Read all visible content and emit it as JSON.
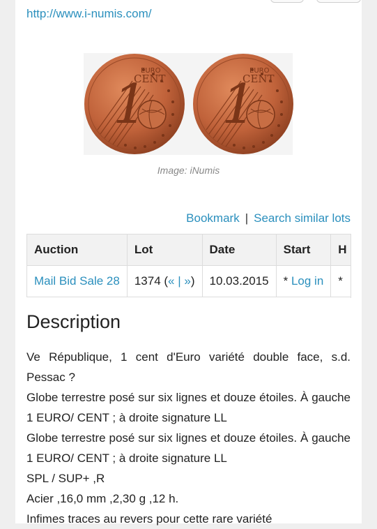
{
  "header": {
    "url": "http://www.i-numis.com/"
  },
  "image": {
    "caption": "Image: iNumis",
    "coin_left": {
      "numeral": "1",
      "label_top": "EURO",
      "label_bottom": "CENT"
    },
    "coin_right": {
      "numeral": "1",
      "label_top": "EURO",
      "label_bottom": "CENT"
    }
  },
  "actions": {
    "bookmark": "Bookmark",
    "separator": "|",
    "search_similar": "Search similar lots"
  },
  "table": {
    "headers": [
      "Auction",
      "Lot",
      "Date",
      "Start",
      "H"
    ],
    "row": {
      "auction": "Mail Bid Sale 28",
      "lot_number": "1374 (",
      "lot_prev": "«",
      "lot_sep": " | ",
      "lot_next": "»",
      "lot_close": ")",
      "date": "10.03.2015",
      "start_prefix": "* ",
      "start_link": "Log in",
      "extra": "*"
    }
  },
  "description": {
    "title": "Description",
    "lines": [
      "Ve République, 1 cent d'Euro variété double face, s.d. Pessac ?",
      "Globe terrestre posé sur six lignes et douze étoiles. À gauche 1 EURO/ CENT ; à droite signature LL",
      "Globe terrestre posé sur six lignes et douze étoiles. À gauche 1 EURO/ CENT ; à droite signature LL",
      "SPL / SUP+ ,R",
      "Acier ,16,0 mm ,2,30 g ,12 h.",
      "Infimes traces au revers pour cette rare variété"
    ]
  },
  "colors": {
    "link": "#2a8fbd",
    "copper": "#c0623a"
  }
}
